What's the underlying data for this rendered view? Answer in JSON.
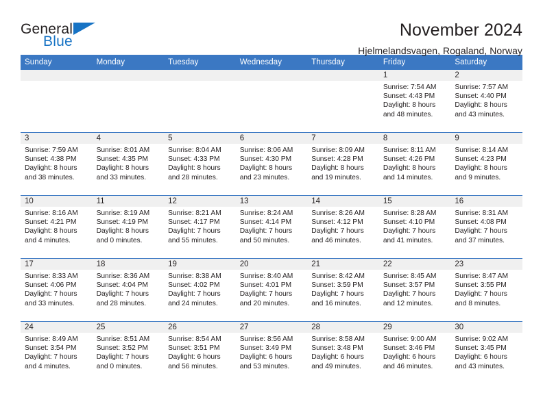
{
  "brand": {
    "name_part1": "General",
    "name_part2": "Blue",
    "accent_color": "#1773c4"
  },
  "header": {
    "title": "November 2024",
    "subtitle": "Hjelmelandsvagen, Rogaland, Norway",
    "header_bg_color": "#3b78c3",
    "daynum_bg_color": "#f0f0f0"
  },
  "weekdays": [
    "Sunday",
    "Monday",
    "Tuesday",
    "Wednesday",
    "Thursday",
    "Friday",
    "Saturday"
  ],
  "weeks": [
    [
      {
        "day": "",
        "blank": true
      },
      {
        "day": "",
        "blank": true
      },
      {
        "day": "",
        "blank": true
      },
      {
        "day": "",
        "blank": true
      },
      {
        "day": "",
        "blank": true
      },
      {
        "day": "1",
        "sunrise": "Sunrise: 7:54 AM",
        "sunset": "Sunset: 4:43 PM",
        "daylight_line1": "Daylight: 8 hours",
        "daylight_line2": "and 48 minutes."
      },
      {
        "day": "2",
        "sunrise": "Sunrise: 7:57 AM",
        "sunset": "Sunset: 4:40 PM",
        "daylight_line1": "Daylight: 8 hours",
        "daylight_line2": "and 43 minutes."
      }
    ],
    [
      {
        "day": "3",
        "sunrise": "Sunrise: 7:59 AM",
        "sunset": "Sunset: 4:38 PM",
        "daylight_line1": "Daylight: 8 hours",
        "daylight_line2": "and 38 minutes."
      },
      {
        "day": "4",
        "sunrise": "Sunrise: 8:01 AM",
        "sunset": "Sunset: 4:35 PM",
        "daylight_line1": "Daylight: 8 hours",
        "daylight_line2": "and 33 minutes."
      },
      {
        "day": "5",
        "sunrise": "Sunrise: 8:04 AM",
        "sunset": "Sunset: 4:33 PM",
        "daylight_line1": "Daylight: 8 hours",
        "daylight_line2": "and 28 minutes."
      },
      {
        "day": "6",
        "sunrise": "Sunrise: 8:06 AM",
        "sunset": "Sunset: 4:30 PM",
        "daylight_line1": "Daylight: 8 hours",
        "daylight_line2": "and 23 minutes."
      },
      {
        "day": "7",
        "sunrise": "Sunrise: 8:09 AM",
        "sunset": "Sunset: 4:28 PM",
        "daylight_line1": "Daylight: 8 hours",
        "daylight_line2": "and 19 minutes."
      },
      {
        "day": "8",
        "sunrise": "Sunrise: 8:11 AM",
        "sunset": "Sunset: 4:26 PM",
        "daylight_line1": "Daylight: 8 hours",
        "daylight_line2": "and 14 minutes."
      },
      {
        "day": "9",
        "sunrise": "Sunrise: 8:14 AM",
        "sunset": "Sunset: 4:23 PM",
        "daylight_line1": "Daylight: 8 hours",
        "daylight_line2": "and 9 minutes."
      }
    ],
    [
      {
        "day": "10",
        "sunrise": "Sunrise: 8:16 AM",
        "sunset": "Sunset: 4:21 PM",
        "daylight_line1": "Daylight: 8 hours",
        "daylight_line2": "and 4 minutes."
      },
      {
        "day": "11",
        "sunrise": "Sunrise: 8:19 AM",
        "sunset": "Sunset: 4:19 PM",
        "daylight_line1": "Daylight: 8 hours",
        "daylight_line2": "and 0 minutes."
      },
      {
        "day": "12",
        "sunrise": "Sunrise: 8:21 AM",
        "sunset": "Sunset: 4:17 PM",
        "daylight_line1": "Daylight: 7 hours",
        "daylight_line2": "and 55 minutes."
      },
      {
        "day": "13",
        "sunrise": "Sunrise: 8:24 AM",
        "sunset": "Sunset: 4:14 PM",
        "daylight_line1": "Daylight: 7 hours",
        "daylight_line2": "and 50 minutes."
      },
      {
        "day": "14",
        "sunrise": "Sunrise: 8:26 AM",
        "sunset": "Sunset: 4:12 PM",
        "daylight_line1": "Daylight: 7 hours",
        "daylight_line2": "and 46 minutes."
      },
      {
        "day": "15",
        "sunrise": "Sunrise: 8:28 AM",
        "sunset": "Sunset: 4:10 PM",
        "daylight_line1": "Daylight: 7 hours",
        "daylight_line2": "and 41 minutes."
      },
      {
        "day": "16",
        "sunrise": "Sunrise: 8:31 AM",
        "sunset": "Sunset: 4:08 PM",
        "daylight_line1": "Daylight: 7 hours",
        "daylight_line2": "and 37 minutes."
      }
    ],
    [
      {
        "day": "17",
        "sunrise": "Sunrise: 8:33 AM",
        "sunset": "Sunset: 4:06 PM",
        "daylight_line1": "Daylight: 7 hours",
        "daylight_line2": "and 33 minutes."
      },
      {
        "day": "18",
        "sunrise": "Sunrise: 8:36 AM",
        "sunset": "Sunset: 4:04 PM",
        "daylight_line1": "Daylight: 7 hours",
        "daylight_line2": "and 28 minutes."
      },
      {
        "day": "19",
        "sunrise": "Sunrise: 8:38 AM",
        "sunset": "Sunset: 4:02 PM",
        "daylight_line1": "Daylight: 7 hours",
        "daylight_line2": "and 24 minutes."
      },
      {
        "day": "20",
        "sunrise": "Sunrise: 8:40 AM",
        "sunset": "Sunset: 4:01 PM",
        "daylight_line1": "Daylight: 7 hours",
        "daylight_line2": "and 20 minutes."
      },
      {
        "day": "21",
        "sunrise": "Sunrise: 8:42 AM",
        "sunset": "Sunset: 3:59 PM",
        "daylight_line1": "Daylight: 7 hours",
        "daylight_line2": "and 16 minutes."
      },
      {
        "day": "22",
        "sunrise": "Sunrise: 8:45 AM",
        "sunset": "Sunset: 3:57 PM",
        "daylight_line1": "Daylight: 7 hours",
        "daylight_line2": "and 12 minutes."
      },
      {
        "day": "23",
        "sunrise": "Sunrise: 8:47 AM",
        "sunset": "Sunset: 3:55 PM",
        "daylight_line1": "Daylight: 7 hours",
        "daylight_line2": "and 8 minutes."
      }
    ],
    [
      {
        "day": "24",
        "sunrise": "Sunrise: 8:49 AM",
        "sunset": "Sunset: 3:54 PM",
        "daylight_line1": "Daylight: 7 hours",
        "daylight_line2": "and 4 minutes."
      },
      {
        "day": "25",
        "sunrise": "Sunrise: 8:51 AM",
        "sunset": "Sunset: 3:52 PM",
        "daylight_line1": "Daylight: 7 hours",
        "daylight_line2": "and 0 minutes."
      },
      {
        "day": "26",
        "sunrise": "Sunrise: 8:54 AM",
        "sunset": "Sunset: 3:51 PM",
        "daylight_line1": "Daylight: 6 hours",
        "daylight_line2": "and 56 minutes."
      },
      {
        "day": "27",
        "sunrise": "Sunrise: 8:56 AM",
        "sunset": "Sunset: 3:49 PM",
        "daylight_line1": "Daylight: 6 hours",
        "daylight_line2": "and 53 minutes."
      },
      {
        "day": "28",
        "sunrise": "Sunrise: 8:58 AM",
        "sunset": "Sunset: 3:48 PM",
        "daylight_line1": "Daylight: 6 hours",
        "daylight_line2": "and 49 minutes."
      },
      {
        "day": "29",
        "sunrise": "Sunrise: 9:00 AM",
        "sunset": "Sunset: 3:46 PM",
        "daylight_line1": "Daylight: 6 hours",
        "daylight_line2": "and 46 minutes."
      },
      {
        "day": "30",
        "sunrise": "Sunrise: 9:02 AM",
        "sunset": "Sunset: 3:45 PM",
        "daylight_line1": "Daylight: 6 hours",
        "daylight_line2": "and 43 minutes."
      }
    ]
  ]
}
